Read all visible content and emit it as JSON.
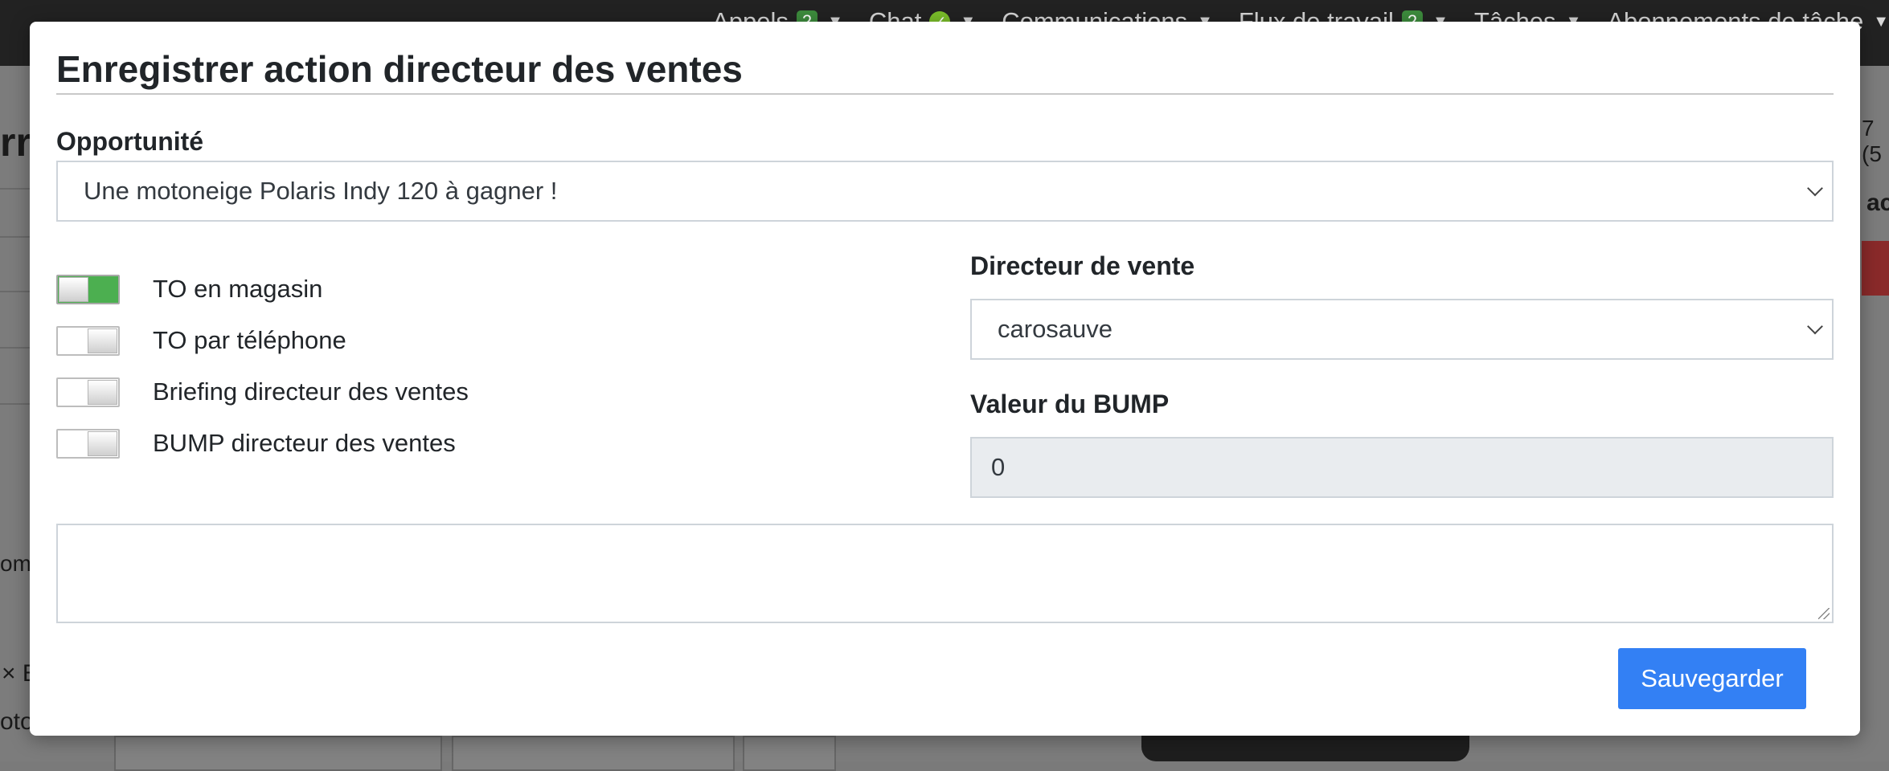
{
  "background": {
    "nav": [
      {
        "label": "Appels",
        "badge": "2"
      },
      {
        "label": "Chat",
        "status": "check"
      },
      {
        "label": "Communications"
      },
      {
        "label": "Flux de travail",
        "badge": "2"
      },
      {
        "label": "Tâches"
      },
      {
        "label": "Abonnements de tâche"
      }
    ],
    "fragments": {
      "left_title": "rr",
      "left_input": "om",
      "left_chip": "× B",
      "left_bottom": "oto",
      "right_count": "7 (5",
      "right_tab": "ac"
    }
  },
  "modal": {
    "title": "Enregistrer action directeur des ventes",
    "opportunity": {
      "label": "Opportunité",
      "value": "Une motoneige Polaris Indy 120 à gagner !"
    },
    "toggles": [
      {
        "label": "TO en magasin",
        "checked": true
      },
      {
        "label": "TO par téléphone",
        "checked": false
      },
      {
        "label": "Briefing directeur des ventes",
        "checked": false
      },
      {
        "label": "BUMP directeur des ventes",
        "checked": false
      }
    ],
    "director": {
      "label": "Directeur de vente",
      "value": "carosauve"
    },
    "bump": {
      "label": "Valeur du BUMP",
      "value": "0"
    },
    "notes": {
      "value": ""
    },
    "save_label": "Sauvegarder"
  },
  "colors": {
    "primary_button": "#3380f4",
    "toggle_on": "#4caf50",
    "readonly_bg": "#e9ecef"
  }
}
